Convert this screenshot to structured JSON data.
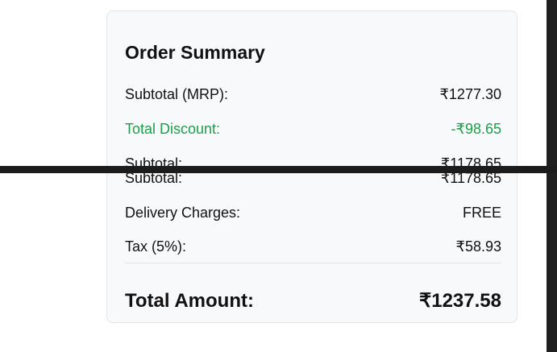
{
  "order_summary": {
    "title": "Order Summary",
    "rows": [
      {
        "label": "Subtotal (MRP):",
        "value": "₹1277.30"
      },
      {
        "label": "Total Discount:",
        "value": "-₹98.65"
      },
      {
        "label": "Subtotal:",
        "value": "₹1178.65"
      },
      {
        "label": "Subtotal:",
        "value": "₹1178.65"
      },
      {
        "label": "Delivery Charges:",
        "value": "FREE"
      },
      {
        "label": "Tax (5%):",
        "value": "₹58.93"
      }
    ],
    "total": {
      "label": "Total Amount:",
      "value": "₹1237.58"
    },
    "colors": {
      "discount": "#1e9e4a",
      "card_background": "#f8f9fb",
      "overlay_bar": "#1c1c1c"
    }
  }
}
